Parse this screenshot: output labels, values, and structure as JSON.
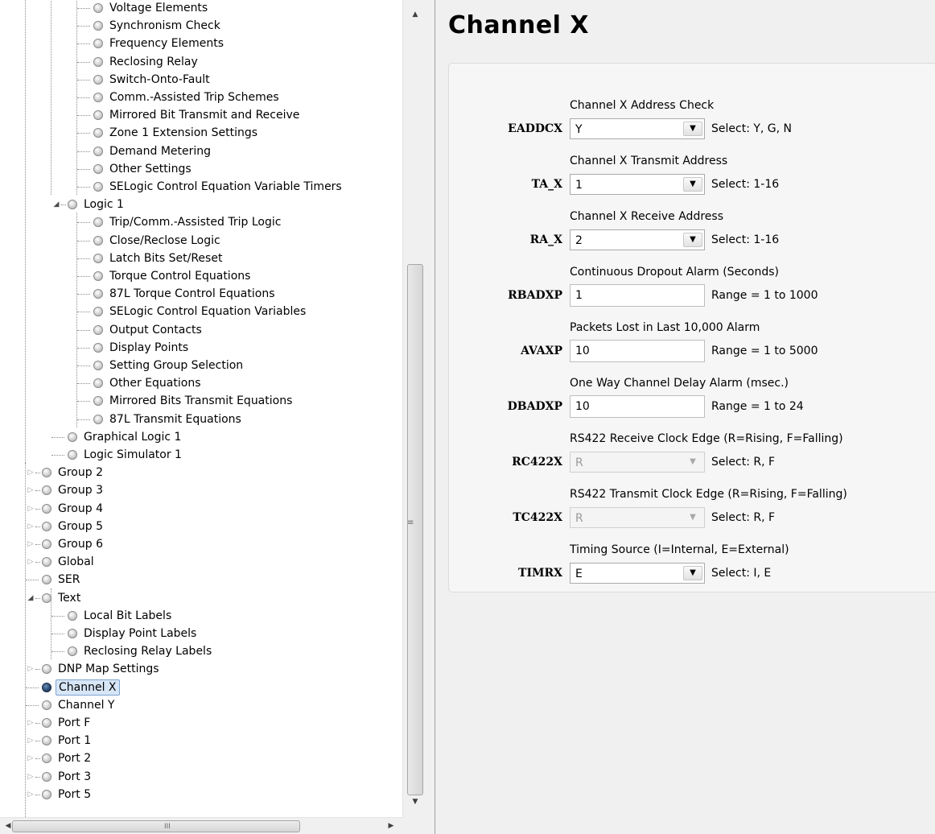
{
  "tree": {
    "rows": [
      {
        "label": "Voltage Elements",
        "depth": 3,
        "expander": "none",
        "active": false,
        "selected": false
      },
      {
        "label": "Synchronism Check",
        "depth": 3,
        "expander": "none",
        "active": false,
        "selected": false
      },
      {
        "label": "Frequency Elements",
        "depth": 3,
        "expander": "none",
        "active": false,
        "selected": false
      },
      {
        "label": "Reclosing Relay",
        "depth": 3,
        "expander": "none",
        "active": false,
        "selected": false
      },
      {
        "label": "Switch-Onto-Fault",
        "depth": 3,
        "expander": "none",
        "active": false,
        "selected": false
      },
      {
        "label": "Comm.-Assisted Trip Schemes",
        "depth": 3,
        "expander": "none",
        "active": false,
        "selected": false
      },
      {
        "label": "Mirrored Bit Transmit and Receive",
        "depth": 3,
        "expander": "none",
        "active": false,
        "selected": false
      },
      {
        "label": "Zone 1 Extension Settings",
        "depth": 3,
        "expander": "none",
        "active": false,
        "selected": false
      },
      {
        "label": "Demand Metering",
        "depth": 3,
        "expander": "none",
        "active": false,
        "selected": false
      },
      {
        "label": "Other Settings",
        "depth": 3,
        "expander": "none",
        "active": false,
        "selected": false
      },
      {
        "label": "SELogic Control Equation Variable Timers",
        "depth": 3,
        "expander": "none",
        "active": false,
        "selected": false
      },
      {
        "label": "Logic 1",
        "depth": 2,
        "expander": "expanded",
        "active": false,
        "selected": false
      },
      {
        "label": "Trip/Comm.-Assisted Trip Logic",
        "depth": 3,
        "expander": "none",
        "active": false,
        "selected": false
      },
      {
        "label": "Close/Reclose Logic",
        "depth": 3,
        "expander": "none",
        "active": false,
        "selected": false
      },
      {
        "label": "Latch Bits Set/Reset",
        "depth": 3,
        "expander": "none",
        "active": false,
        "selected": false
      },
      {
        "label": "Torque Control Equations",
        "depth": 3,
        "expander": "none",
        "active": false,
        "selected": false
      },
      {
        "label": "87L Torque Control Equations",
        "depth": 3,
        "expander": "none",
        "active": false,
        "selected": false
      },
      {
        "label": "SELogic Control Equation Variables",
        "depth": 3,
        "expander": "none",
        "active": false,
        "selected": false
      },
      {
        "label": "Output Contacts",
        "depth": 3,
        "expander": "none",
        "active": false,
        "selected": false
      },
      {
        "label": "Display Points",
        "depth": 3,
        "expander": "none",
        "active": false,
        "selected": false
      },
      {
        "label": "Setting Group Selection",
        "depth": 3,
        "expander": "none",
        "active": false,
        "selected": false
      },
      {
        "label": "Other Equations",
        "depth": 3,
        "expander": "none",
        "active": false,
        "selected": false
      },
      {
        "label": "Mirrored Bits Transmit Equations",
        "depth": 3,
        "expander": "none",
        "active": false,
        "selected": false
      },
      {
        "label": "87L Transmit Equations",
        "depth": 3,
        "expander": "none",
        "active": false,
        "selected": false
      },
      {
        "label": "Graphical Logic 1",
        "depth": 2,
        "expander": "none",
        "active": false,
        "selected": false
      },
      {
        "label": "Logic Simulator 1",
        "depth": 2,
        "expander": "none",
        "active": false,
        "selected": false
      },
      {
        "label": "Group 2",
        "depth": 1,
        "expander": "collapsed",
        "active": false,
        "selected": false
      },
      {
        "label": "Group 3",
        "depth": 1,
        "expander": "collapsed",
        "active": false,
        "selected": false
      },
      {
        "label": "Group 4",
        "depth": 1,
        "expander": "collapsed",
        "active": false,
        "selected": false
      },
      {
        "label": "Group 5",
        "depth": 1,
        "expander": "collapsed",
        "active": false,
        "selected": false
      },
      {
        "label": "Group 6",
        "depth": 1,
        "expander": "collapsed",
        "active": false,
        "selected": false
      },
      {
        "label": "Global",
        "depth": 1,
        "expander": "collapsed",
        "active": false,
        "selected": false
      },
      {
        "label": "SER",
        "depth": 1,
        "expander": "none",
        "active": false,
        "selected": false
      },
      {
        "label": "Text",
        "depth": 1,
        "expander": "expanded",
        "active": false,
        "selected": false
      },
      {
        "label": "Local Bit Labels",
        "depth": 2,
        "expander": "none",
        "active": false,
        "selected": false
      },
      {
        "label": "Display Point Labels",
        "depth": 2,
        "expander": "none",
        "active": false,
        "selected": false
      },
      {
        "label": "Reclosing Relay Labels",
        "depth": 2,
        "expander": "none",
        "active": false,
        "selected": false
      },
      {
        "label": "DNP Map Settings",
        "depth": 1,
        "expander": "collapsed",
        "active": false,
        "selected": false
      },
      {
        "label": "Channel X",
        "depth": 1,
        "expander": "none",
        "active": true,
        "selected": true
      },
      {
        "label": "Channel Y",
        "depth": 1,
        "expander": "none",
        "active": false,
        "selected": false
      },
      {
        "label": "Port F",
        "depth": 1,
        "expander": "collapsed",
        "active": false,
        "selected": false
      },
      {
        "label": "Port 1",
        "depth": 1,
        "expander": "collapsed",
        "active": false,
        "selected": false
      },
      {
        "label": "Port 2",
        "depth": 1,
        "expander": "collapsed",
        "active": false,
        "selected": false
      },
      {
        "label": "Port 3",
        "depth": 1,
        "expander": "collapsed",
        "active": false,
        "selected": false
      },
      {
        "label": "Port 5",
        "depth": 1,
        "expander": "collapsed",
        "active": false,
        "selected": false
      }
    ],
    "icons": {
      "expanded": "triangle-expanded-icon",
      "collapsed": "triangle-collapsed-icon",
      "node": "setting-node-icon"
    }
  },
  "scrollbars": {
    "up_glyph": "▲",
    "down_glyph": "▼",
    "left_glyph": "◀",
    "right_glyph": "▶",
    "grip_v": "≡",
    "grip_h": "III"
  },
  "page": {
    "title": "Channel X"
  },
  "settings": [
    {
      "name": "EADDCX",
      "description": "Channel X Address Check",
      "control": "select",
      "value": "Y",
      "enabled": true,
      "hint": "Select: Y, G, N"
    },
    {
      "name": "TA_X",
      "description": "Channel X Transmit Address",
      "control": "select",
      "value": "1",
      "enabled": true,
      "hint": "Select: 1-16"
    },
    {
      "name": "RA_X",
      "description": "Channel X Receive Address",
      "control": "select",
      "value": "2",
      "enabled": true,
      "hint": "Select: 1-16"
    },
    {
      "name": "RBADXP",
      "description": "Continuous Dropout Alarm (Seconds)",
      "control": "input",
      "value": "1",
      "enabled": true,
      "hint": "Range = 1 to 1000"
    },
    {
      "name": "AVAXP",
      "description": "Packets Lost in Last 10,000 Alarm",
      "control": "input",
      "value": "10",
      "enabled": true,
      "hint": "Range = 1 to 5000"
    },
    {
      "name": "DBADXP",
      "description": "One Way Channel Delay Alarm (msec.)",
      "control": "input",
      "value": "10",
      "enabled": true,
      "hint": "Range = 1 to 24"
    },
    {
      "name": "RC422X",
      "description": "RS422 Receive Clock Edge (R=Rising, F=Falling)",
      "control": "select",
      "value": "R",
      "enabled": false,
      "hint": "Select: R, F"
    },
    {
      "name": "TC422X",
      "description": "RS422 Transmit Clock Edge (R=Rising, F=Falling)",
      "control": "select",
      "value": "R",
      "enabled": false,
      "hint": "Select: R, F"
    },
    {
      "name": "TIMRX",
      "description": "Timing Source (I=Internal, E=External)",
      "control": "select",
      "value": "E",
      "enabled": true,
      "hint": "Select: I, E"
    }
  ],
  "colors": {
    "selected_bg": "#d7e6f7",
    "selected_border": "#7da2ce",
    "active_icon": "#2a4a73",
    "panel_bg": "#f0f0f0"
  }
}
